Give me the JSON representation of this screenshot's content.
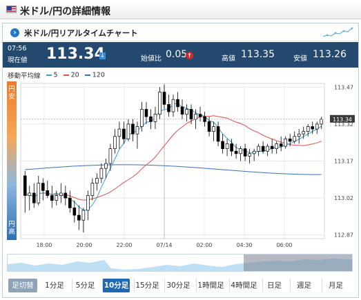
{
  "page": {
    "title": "米ドル/円の詳細情報"
  },
  "widget": {
    "title": "米ドル/円リアルタイムチャート"
  },
  "quote": {
    "time": "07:56",
    "current_label": "現在値",
    "current": "113.34",
    "change_label": "始値比",
    "change": "0.05",
    "high_label": "高値",
    "high": "113.35",
    "low_label": "安値",
    "low": "113.26"
  },
  "ma_legend": {
    "label": "移動平均線",
    "items": [
      {
        "label": "5",
        "color": "#3aa0c9"
      },
      {
        "label": "20",
        "color": "#d9534f"
      },
      {
        "label": "120",
        "color": "#3a6eb5"
      }
    ]
  },
  "side": {
    "top": "円安",
    "bottom": "円高"
  },
  "icons": {
    "flag": "us-flag-icon",
    "chevron": "chevron-right-icon",
    "down": "arrow-down-icon",
    "up": "arrow-up-icon",
    "sparkline": "sparkline-icon"
  },
  "colors": {
    "up_candle": "#ffffff",
    "down_candle": "#000000",
    "ma5": "#3aa0c9",
    "ma20": "#d9534f",
    "ma120": "#3a6eb5",
    "quote_bar": "#24496f",
    "active_tab": "#1f68b5"
  },
  "chart_data": {
    "type": "candlestick",
    "xlabels": [
      "18:00",
      "20:00",
      "22:00",
      "07/14",
      "02:00",
      "04:30",
      "06:00"
    ],
    "ylabels": [
      "113.47",
      "113.32",
      "113.17",
      "113.02",
      "112.87"
    ],
    "ylim": [
      112.855,
      113.485
    ],
    "last_price": "113.34",
    "candles": [
      [
        113.11,
        113.13,
        112.96,
        113.03
      ],
      [
        113.03,
        113.07,
        112.97,
        113.04
      ],
      [
        113.04,
        113.08,
        112.98,
        113.0
      ],
      [
        113.0,
        113.11,
        112.99,
        113.08
      ],
      [
        113.08,
        113.1,
        113.01,
        113.05
      ],
      [
        113.05,
        113.09,
        113.02,
        113.03
      ],
      [
        113.03,
        113.07,
        112.98,
        113.01
      ],
      [
        113.01,
        113.05,
        112.99,
        113.03
      ],
      [
        113.03,
        113.08,
        113.0,
        113.04
      ],
      [
        113.04,
        113.07,
        112.99,
        113.02
      ],
      [
        113.02,
        113.05,
        112.96,
        112.98
      ],
      [
        112.98,
        113.01,
        112.92,
        112.95
      ],
      [
        112.95,
        112.99,
        112.89,
        112.93
      ],
      [
        112.93,
        112.98,
        112.88,
        112.97
      ],
      [
        112.97,
        113.05,
        112.93,
        113.03
      ],
      [
        113.03,
        113.1,
        113.01,
        113.08
      ],
      [
        113.08,
        113.12,
        113.05,
        113.1
      ],
      [
        113.1,
        113.16,
        113.08,
        113.14
      ],
      [
        113.14,
        113.18,
        113.1,
        113.16
      ],
      [
        113.16,
        113.24,
        113.13,
        113.22
      ],
      [
        113.22,
        113.3,
        113.2,
        113.27
      ],
      [
        113.27,
        113.33,
        113.22,
        113.3
      ],
      [
        113.3,
        113.33,
        113.24,
        113.26
      ],
      [
        113.26,
        113.34,
        113.25,
        113.32
      ],
      [
        113.32,
        113.34,
        113.25,
        113.28
      ],
      [
        113.28,
        113.33,
        113.22,
        113.31
      ],
      [
        113.31,
        113.41,
        113.29,
        113.38
      ],
      [
        113.38,
        113.41,
        113.32,
        113.35
      ],
      [
        113.35,
        113.38,
        113.3,
        113.33
      ],
      [
        113.33,
        113.39,
        113.3,
        113.36
      ],
      [
        113.36,
        113.47,
        113.34,
        113.45
      ],
      [
        113.45,
        113.48,
        113.38,
        113.4
      ],
      [
        113.4,
        113.44,
        113.35,
        113.37
      ],
      [
        113.37,
        113.44,
        113.35,
        113.42
      ],
      [
        113.42,
        113.45,
        113.37,
        113.39
      ],
      [
        113.39,
        113.42,
        113.34,
        113.36
      ],
      [
        113.36,
        113.4,
        113.33,
        113.38
      ],
      [
        113.38,
        113.4,
        113.32,
        113.34
      ],
      [
        113.34,
        113.38,
        113.3,
        113.36
      ],
      [
        113.36,
        113.39,
        113.33,
        113.35
      ],
      [
        113.35,
        113.37,
        113.31,
        113.33
      ],
      [
        113.33,
        113.35,
        113.27,
        113.29
      ],
      [
        113.29,
        113.33,
        113.25,
        113.31
      ],
      [
        113.31,
        113.33,
        113.23,
        113.25
      ],
      [
        113.25,
        113.28,
        113.2,
        113.22
      ],
      [
        113.22,
        113.26,
        113.19,
        113.24
      ],
      [
        113.24,
        113.26,
        113.19,
        113.21
      ],
      [
        113.21,
        113.24,
        113.18,
        113.2
      ],
      [
        113.2,
        113.23,
        113.17,
        113.22
      ],
      [
        113.22,
        113.24,
        113.17,
        113.19
      ],
      [
        113.19,
        113.22,
        113.16,
        113.2
      ],
      [
        113.2,
        113.22,
        113.17,
        113.21
      ],
      [
        113.21,
        113.24,
        113.19,
        113.23
      ],
      [
        113.23,
        113.25,
        113.2,
        113.21
      ],
      [
        113.21,
        113.24,
        113.19,
        113.23
      ],
      [
        113.23,
        113.26,
        113.2,
        113.22
      ],
      [
        113.22,
        113.25,
        113.2,
        113.24
      ],
      [
        113.24,
        113.27,
        113.21,
        113.23
      ],
      [
        113.23,
        113.27,
        113.22,
        113.26
      ],
      [
        113.26,
        113.28,
        113.23,
        113.25
      ],
      [
        113.25,
        113.29,
        113.24,
        113.27
      ],
      [
        113.27,
        113.3,
        113.24,
        113.28
      ],
      [
        113.28,
        113.31,
        113.26,
        113.29
      ],
      [
        113.29,
        113.32,
        113.27,
        113.31
      ],
      [
        113.31,
        113.33,
        113.28,
        113.3
      ],
      [
        113.3,
        113.33,
        113.28,
        113.32
      ],
      [
        113.32,
        113.35,
        113.3,
        113.34
      ]
    ]
  },
  "tabs": [
    {
      "label": "足切替",
      "state": "label"
    },
    {
      "label": "1分足",
      "state": "normal"
    },
    {
      "label": "5分足",
      "state": "normal"
    },
    {
      "label": "10分足",
      "state": "active"
    },
    {
      "label": "15分足",
      "state": "normal"
    },
    {
      "label": "30分足",
      "state": "normal"
    },
    {
      "label": "1時間足",
      "state": "normal"
    },
    {
      "label": "4時間足",
      "state": "normal"
    },
    {
      "label": "日足",
      "state": "normal"
    },
    {
      "label": "週足",
      "state": "normal"
    },
    {
      "label": "月足",
      "state": "normal"
    }
  ]
}
